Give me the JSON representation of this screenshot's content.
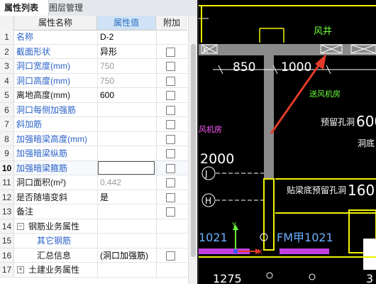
{
  "panel": {
    "tabs": [
      {
        "label": "属性列表",
        "active": true
      },
      {
        "label": "图层管理",
        "active": false
      }
    ],
    "headers": {
      "num": "",
      "name": "属性名称",
      "value": "属性值",
      "attach": "附加"
    },
    "rows": [
      {
        "num": "1",
        "name": "名称",
        "value": "D-2",
        "name_color": "blue",
        "value_color": "black",
        "checkbox": false
      },
      {
        "num": "2",
        "name": "截面形状",
        "value": "异形",
        "name_color": "blue",
        "value_color": "black",
        "checkbox": true
      },
      {
        "num": "3",
        "name": "洞口宽度(mm)",
        "value": "750",
        "name_color": "blue",
        "value_color": "gray",
        "checkbox": true
      },
      {
        "num": "4",
        "name": "洞口高度(mm)",
        "value": "750",
        "name_color": "blue",
        "value_color": "gray",
        "checkbox": true
      },
      {
        "num": "5",
        "name": "离地高度(mm)",
        "value": "600",
        "name_color": "black",
        "value_color": "black",
        "checkbox": true
      },
      {
        "num": "6",
        "name": "洞口每侧加强筋",
        "value": "",
        "name_color": "blue",
        "value_color": "black",
        "checkbox": true
      },
      {
        "num": "7",
        "name": "斜加筋",
        "value": "",
        "name_color": "blue",
        "value_color": "black",
        "checkbox": true
      },
      {
        "num": "8",
        "name": "加强暗梁高度(mm)",
        "value": "",
        "name_color": "blue",
        "value_color": "black",
        "checkbox": true
      },
      {
        "num": "9",
        "name": "加强暗梁纵筋",
        "value": "",
        "name_color": "blue",
        "value_color": "black",
        "checkbox": true
      },
      {
        "num": "10",
        "name": "加强暗梁箍筋",
        "value": "",
        "name_color": "blue",
        "value_color": "black",
        "checkbox": true,
        "selected": true
      },
      {
        "num": "11",
        "name": "洞口面积(m²)",
        "value": "0.442",
        "name_color": "black",
        "value_color": "gray",
        "checkbox": true
      },
      {
        "num": "12",
        "name": "是否随墙变斜",
        "value": "是",
        "name_color": "black",
        "value_color": "black",
        "checkbox": true
      },
      {
        "num": "13",
        "name": "备注",
        "value": "",
        "name_color": "black",
        "value_color": "black",
        "checkbox": true
      },
      {
        "num": "14",
        "name": "钢筋业务属性",
        "value": "",
        "name_color": "black",
        "value_color": "black",
        "checkbox": false,
        "group": true,
        "expander": "−"
      },
      {
        "num": "15",
        "name": "其它钢筋",
        "value": "",
        "name_color": "blue",
        "value_color": "black",
        "checkbox": false,
        "child": true
      },
      {
        "num": "16",
        "name": "汇总信息",
        "value": "(洞口加强筋)",
        "name_color": "black",
        "value_color": "black",
        "checkbox": true,
        "child": true
      },
      {
        "num": "17",
        "name": "土建业务属性",
        "value": "",
        "name_color": "black",
        "value_color": "black",
        "checkbox": false,
        "group": true,
        "expander": "+"
      }
    ]
  },
  "cad": {
    "labels": {
      "fengjing": "风井",
      "dim1": "850",
      "dim2": "1000",
      "songfeng": "送风机房",
      "yuliu": "预留孔洞",
      "yuliu_num": "600",
      "dongdi": "洞底",
      "fengfang": "风机房",
      "dim_left": "2000",
      "axis_j": "J",
      "axis_h": "H",
      "tieliang": "贴梁底预留孔洞",
      "tieliang_num": "160",
      "fm": "FM甲1021",
      "fm_left": "1021",
      "bottom_left": "1275",
      "bottom_right": "3",
      "axis_y": "Y",
      "axis_x": "X",
      "mark_k": "K"
    },
    "colors": {
      "wall_yellow": "#f2f200",
      "column_gray": "#8a8a8a",
      "dim_white": "#ffffff",
      "text_green": "#6cff3a",
      "text_magenta": "#ff5aff",
      "arrow_red": "#e23a2a",
      "door_purple": "#c040e0"
    }
  }
}
